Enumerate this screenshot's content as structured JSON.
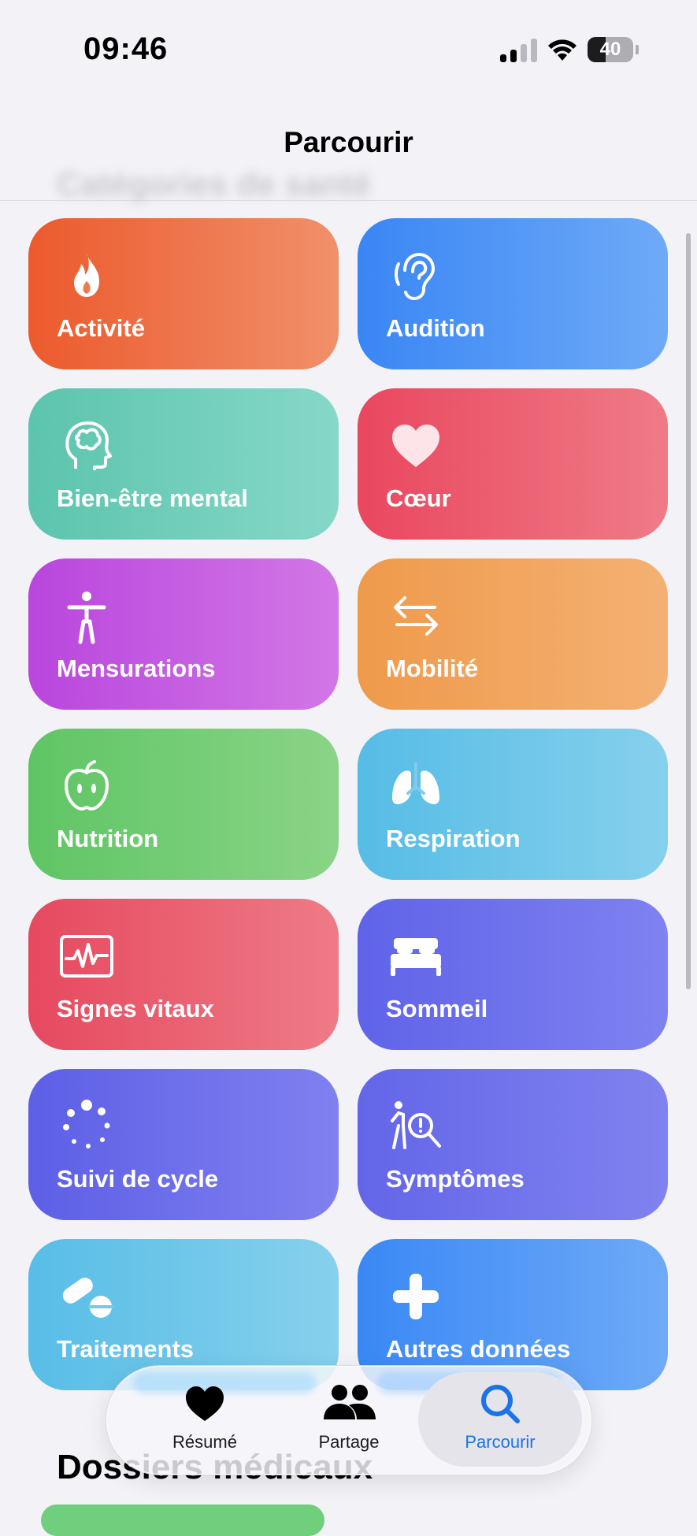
{
  "status_bar": {
    "time": "09:46",
    "battery": "40",
    "battery_level": 0.4
  },
  "nav": {
    "title": "Parcourir",
    "ghost_heading": "Catégories de santé"
  },
  "categories": [
    {
      "label": "Activité",
      "icon": "flame-icon",
      "colors": [
        "#ec5a2d",
        "#f0906a"
      ]
    },
    {
      "label": "Audition",
      "icon": "ear-icon",
      "colors": [
        "#3a86f5",
        "#6eaaf7"
      ]
    },
    {
      "label": "Bien-être mental",
      "icon": "brain-head-icon",
      "colors": [
        "#5cc4ad",
        "#86d8c8"
      ]
    },
    {
      "label": "Cœur",
      "icon": "heart-icon",
      "colors": [
        "#e9475f",
        "#ef7b86"
      ]
    },
    {
      "label": "Mensurations",
      "icon": "figure-icon",
      "colors": [
        "#b946dd",
        "#d277e6"
      ]
    },
    {
      "label": "Mobilité",
      "icon": "arrows-left-right-icon",
      "colors": [
        "#ef9a4b",
        "#f4b173"
      ]
    },
    {
      "label": "Nutrition",
      "icon": "apple-icon",
      "colors": [
        "#5fc564",
        "#8ad487"
      ]
    },
    {
      "label": "Respiration",
      "icon": "lungs-icon",
      "colors": [
        "#56bce6",
        "#86d0ec"
      ]
    },
    {
      "label": "Signes vitaux",
      "icon": "waveform-monitor-icon",
      "colors": [
        "#e6495f",
        "#ee7b86"
      ]
    },
    {
      "label": "Sommeil",
      "icon": "bed-icon",
      "colors": [
        "#5f63e8",
        "#7f82f0"
      ]
    },
    {
      "label": "Suivi de cycle",
      "icon": "cycle-dots-icon",
      "colors": [
        "#5d5fe6",
        "#8080f0"
      ]
    },
    {
      "label": "Symptômes",
      "icon": "figure-magnifier-icon",
      "colors": [
        "#6366e8",
        "#8082ef"
      ]
    },
    {
      "label": "Traitements",
      "icon": "pills-icon",
      "colors": [
        "#58bde7",
        "#86d1ec"
      ]
    },
    {
      "label": "Autres données",
      "icon": "plus-icon",
      "colors": [
        "#3a88f5",
        "#6eaaf7"
      ]
    }
  ],
  "section": {
    "title": "Dossiers médicaux"
  },
  "tab_bar": {
    "tabs": [
      {
        "label": "Résumé",
        "icon": "heart-icon"
      },
      {
        "label": "Partage",
        "icon": "people-icon"
      },
      {
        "label": "Parcourir",
        "icon": "search-icon"
      }
    ],
    "active": "Parcourir",
    "active_color": "#1a73e8"
  }
}
